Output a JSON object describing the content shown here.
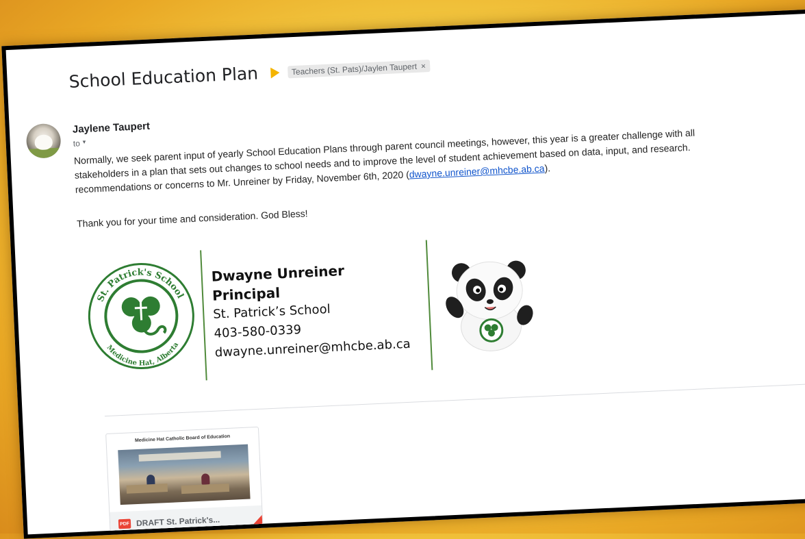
{
  "email": {
    "subject": "School Education Plan",
    "label": "Teachers (St. Pats)/Jaylen Taupert",
    "label_close": "×",
    "sender": "Jaylene Taupert",
    "to_label": "to",
    "caret": "▾",
    "body_lines": [
      "Normally, we seek parent input of yearly School Education Plans through parent council meetings, however, this year is a greater challenge with all",
      "stakeholders in a plan that sets out changes to school needs and to improve the level of student achievement based on data, input, and research."
    ],
    "body_line3_prefix": "recommendations or concerns to Mr. Unreiner by Friday, November 6th, 2020 (",
    "body_line3_link": "dwayne.unreiner@mhcbe.ab.ca",
    "body_line3_suffix": ").",
    "thanks": "Thank you for your time and consideration.  God Bless!"
  },
  "signature": {
    "name": "Dwayne Unreiner",
    "title": "Principal",
    "school": "St. Patrick’s School",
    "phone": "403-580-0339",
    "email": "dwayne.unreiner@mhcbe.ab.ca",
    "logo_top_text": "St. Patrick's School",
    "logo_bottom_text": "Medicine Hat, Alberta"
  },
  "attachment": {
    "heading": "Medicine Hat Catholic Board of Education",
    "type_badge": "PDF",
    "name": "DRAFT St. Patrick's..."
  },
  "colors": {
    "accent_green": "#2e7d32",
    "label_arrow": "#f4b400",
    "pdf_red": "#ea4335",
    "link_blue": "#1155cc"
  }
}
